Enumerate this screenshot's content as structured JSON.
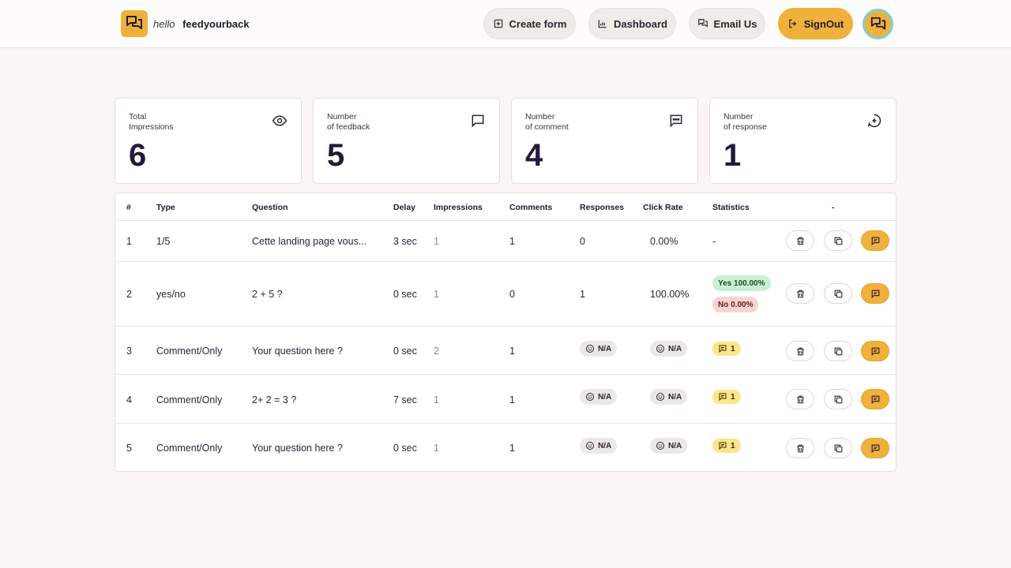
{
  "brand": {
    "hello": "hello",
    "name": "feedyourback"
  },
  "nav": {
    "create": "Create form",
    "dashboard": "Dashboard",
    "email": "Email Us",
    "signout": "SignOut"
  },
  "stats": [
    {
      "label_line1": "Total",
      "label_line2": "Impressions",
      "value": "6",
      "icon": "eye-icon"
    },
    {
      "label_line1": "Number",
      "label_line2": "of feedback",
      "value": "5",
      "icon": "chat-bubble-icon"
    },
    {
      "label_line1": "Number",
      "label_line2": "of comment",
      "value": "4",
      "icon": "comment-dots-icon"
    },
    {
      "label_line1": "Number",
      "label_line2": "of response",
      "value": "1",
      "icon": "reply-icon"
    }
  ],
  "table": {
    "headers": [
      "#",
      "Type",
      "Question",
      "Delay",
      "Impressions",
      "Comments",
      "Responses",
      "Click Rate",
      "Statistics",
      "-"
    ],
    "rows": [
      {
        "num": "1",
        "type": "1/5",
        "question": "Cette landing page vous...",
        "delay": "3 sec",
        "impressions": "1",
        "comments": "1",
        "responses": "0",
        "click_rate": "0.00%",
        "stats": "-"
      },
      {
        "num": "2",
        "type": "yes/no",
        "question": "2 + 5 ?",
        "delay": "0 sec",
        "impressions": "1",
        "comments": "0",
        "responses": "1",
        "click_rate": "100.00%",
        "stat_yes": "Yes 100.00%",
        "stat_no": "No 0.00%"
      },
      {
        "num": "3",
        "type": "Comment/Only",
        "question": "Your question here ?",
        "delay": "0 sec",
        "impressions": "2",
        "comments": "1",
        "responses": "N/A",
        "click_rate": "N/A",
        "stat_count": "1"
      },
      {
        "num": "4",
        "type": "Comment/Only",
        "question": "2+ 2 = 3 ?",
        "delay": "7 sec",
        "impressions": "1",
        "comments": "1",
        "responses": "N/A",
        "click_rate": "N/A",
        "stat_count": "1"
      },
      {
        "num": "5",
        "type": "Comment/Only",
        "question": "Your question here ?",
        "delay": "0 sec",
        "impressions": "1",
        "comments": "1",
        "responses": "N/A",
        "click_rate": "N/A",
        "stat_count": "1"
      }
    ]
  },
  "colors": {
    "accent": "#f0b03c",
    "background": "#f9f6f3",
    "yes": "#c9f0d3",
    "no": "#fbd3d3",
    "comment_badge": "#fbe58a"
  }
}
